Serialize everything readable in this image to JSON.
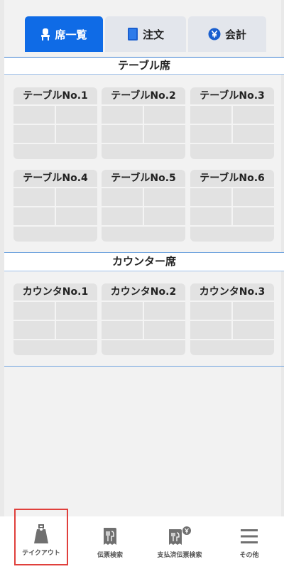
{
  "tabs": [
    {
      "label": "席一覧",
      "icon": "seat-icon",
      "active": true
    },
    {
      "label": "注文",
      "icon": "book-icon",
      "active": false
    },
    {
      "label": "会計",
      "icon": "yen-icon",
      "active": false
    }
  ],
  "sections": [
    {
      "title": "テーブル席",
      "tables": [
        "テーブルNo.1",
        "テーブルNo.2",
        "テーブルNo.3",
        "テーブルNo.4",
        "テーブルNo.5",
        "テーブルNo.6"
      ]
    },
    {
      "title": "カウンター席",
      "tables": [
        "カウンタNo.1",
        "カウンタNo.2",
        "カウンタNo.3"
      ]
    }
  ],
  "bottom_nav": [
    {
      "label": "テイクアウト",
      "icon": "takeout-bag-icon",
      "selected": true
    },
    {
      "label": "伝票検索",
      "icon": "receipt-search-icon",
      "selected": false
    },
    {
      "label": "支払済伝票検索",
      "icon": "paid-receipt-search-icon",
      "selected": false
    },
    {
      "label": "その他",
      "icon": "menu-icon",
      "selected": false
    }
  ],
  "colors": {
    "accent": "#0f6be6",
    "tab_inactive": "#e3e6ec",
    "card": "#e2e2e2",
    "section_line": "#3c7fd1",
    "highlight": "#e0403c"
  }
}
